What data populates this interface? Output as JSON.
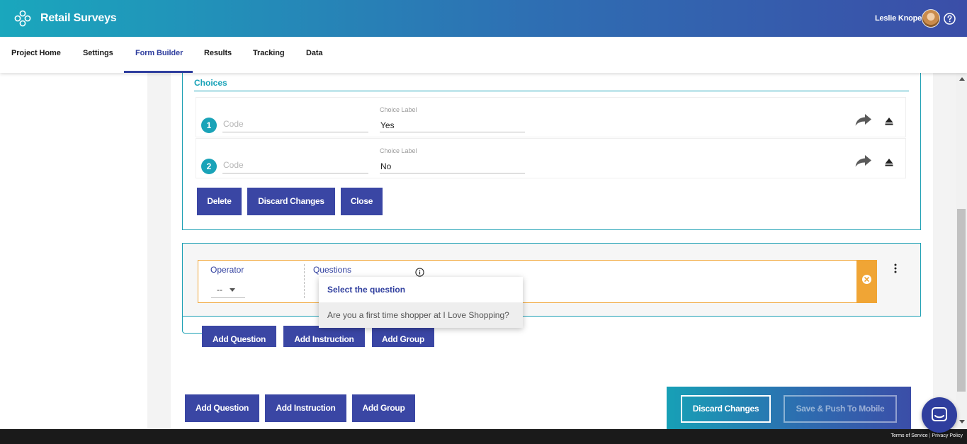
{
  "header": {
    "app_title": "Retail Surveys",
    "user_name": "Leslie Knope",
    "logo_icon": "flower-logo-icon",
    "help_icon": "question-circle-icon"
  },
  "nav": {
    "tabs": [
      {
        "label": "Project Home",
        "active": false
      },
      {
        "label": "Settings",
        "active": false
      },
      {
        "label": "Form Builder",
        "active": true
      },
      {
        "label": "Results",
        "active": false
      },
      {
        "label": "Tracking",
        "active": false
      },
      {
        "label": "Data",
        "active": false
      }
    ]
  },
  "choices": {
    "title": "Choices",
    "code_placeholder": "Code",
    "label_caption": "Choice Label",
    "items": [
      {
        "number": "1",
        "label": "Yes"
      },
      {
        "number": "2",
        "label": "No"
      }
    ],
    "buttons": {
      "delete": "Delete",
      "discard": "Discard Changes",
      "close": "Close"
    }
  },
  "condition": {
    "operator_label": "Operator",
    "operator_value": "--",
    "questions_label": "Questions",
    "dropdown": {
      "header": "Select the question",
      "options": [
        "Are you a first time shopper at I Love Shopping?"
      ]
    }
  },
  "group_actions": {
    "add_question": "Add Question",
    "add_instruction": "Add Instruction",
    "add_group": "Add Group"
  },
  "page_actions": {
    "add_question": "Add Question",
    "add_instruction": "Add Instruction",
    "add_group": "Add Group"
  },
  "save_panel": {
    "discard": "Discard Changes",
    "save_push": "Save & Push To Mobile",
    "save_push_enabled": false
  },
  "footer": {
    "terms": "Terms of Service",
    "privacy": "Privacy Policy"
  },
  "colors": {
    "brand_teal": "#1aa3b8",
    "brand_indigo": "#3a46a4",
    "warning_orange": "#f0a535"
  }
}
